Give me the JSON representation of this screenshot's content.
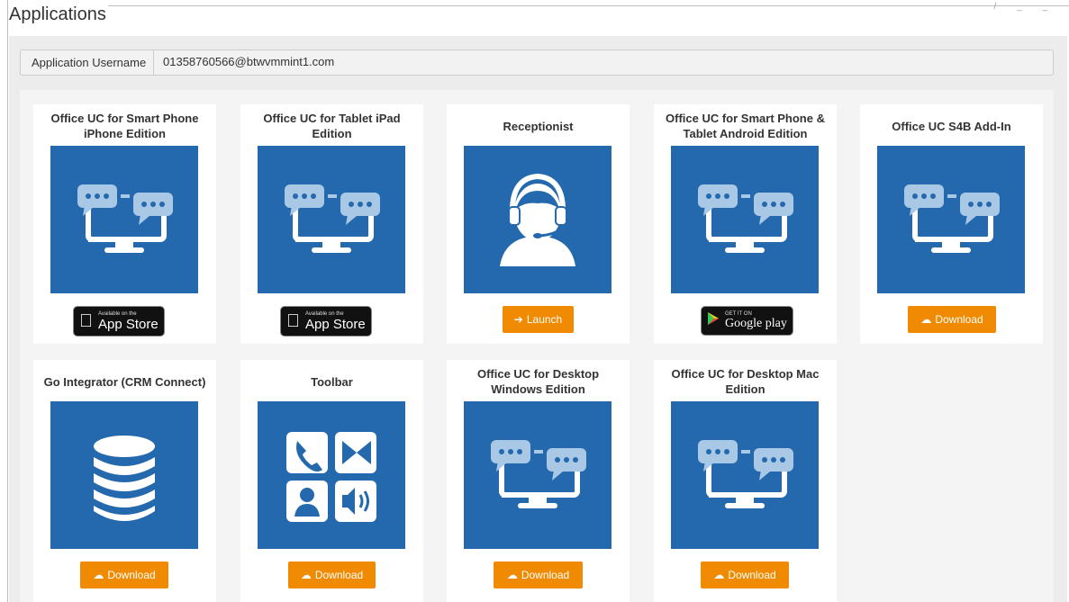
{
  "page": {
    "title": "Applications",
    "corner_marks": "/  _  _"
  },
  "info": {
    "label": "Application Username",
    "value": "01358760566@btwvmmint1.com"
  },
  "colors": {
    "tile_blue": "#2469ad",
    "button_orange": "#f08a00",
    "panel_gray": "#ececec"
  },
  "apps": [
    {
      "title": "Office UC for Smart Phone iPhone Edition",
      "icon": "chat-monitor-icon",
      "action": {
        "type": "appstore",
        "small": "Available on the",
        "big": "App Store"
      }
    },
    {
      "title": "Office UC for Tablet iPad Edition",
      "icon": "chat-monitor-icon",
      "action": {
        "type": "appstore",
        "small": "Available on the",
        "big": "App Store"
      }
    },
    {
      "title": "Receptionist",
      "icon": "headset-icon",
      "action": {
        "type": "button",
        "label": "Launch",
        "icon": "arrow-right-icon"
      }
    },
    {
      "title": "Office UC for Smart Phone & Tablet Android Edition",
      "icon": "chat-monitor-icon",
      "action": {
        "type": "googleplay",
        "small": "GET IT ON",
        "big": "Google play"
      }
    },
    {
      "title": "Office UC S4B Add-In",
      "icon": "chat-monitor-icon",
      "action": {
        "type": "button",
        "label": "Download",
        "icon": "cloud-download-icon"
      }
    },
    {
      "title": "Go Integrator (CRM Connect)",
      "icon": "database-icon",
      "action": {
        "type": "button",
        "label": "Download",
        "icon": "cloud-download-icon"
      }
    },
    {
      "title": "Toolbar",
      "icon": "toolbar-icon",
      "action": {
        "type": "button",
        "label": "Download",
        "icon": "cloud-download-icon"
      }
    },
    {
      "title": "Office UC for Desktop Windows Edition",
      "icon": "chat-monitor-icon",
      "action": {
        "type": "button",
        "label": "Download",
        "icon": "cloud-download-icon"
      }
    },
    {
      "title": "Office UC for Desktop Mac Edition",
      "icon": "chat-monitor-icon",
      "action": {
        "type": "button",
        "label": "Download",
        "icon": "cloud-download-icon"
      }
    }
  ]
}
